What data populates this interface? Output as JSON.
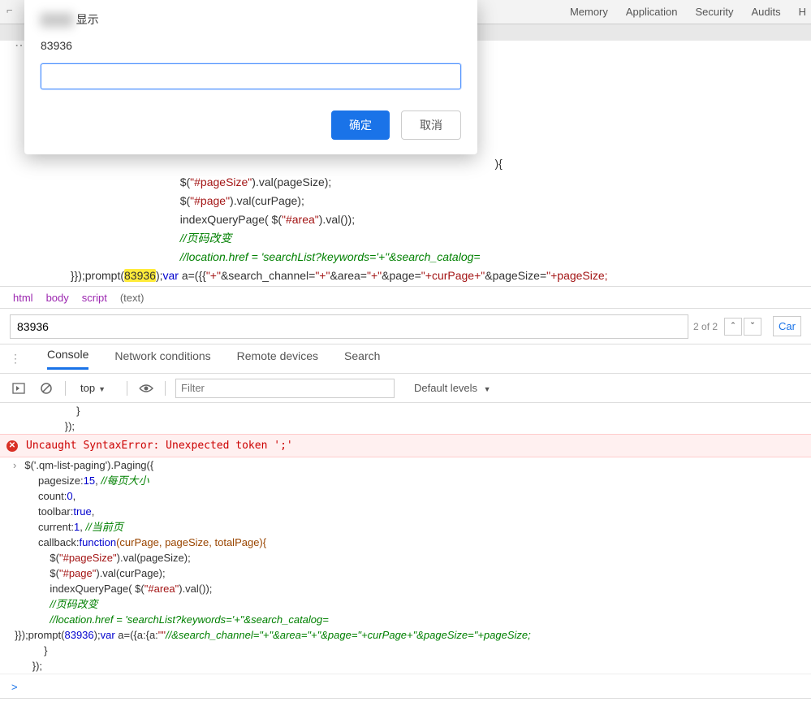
{
  "dialog": {
    "title_prefix": "████",
    "title_suffix": "显示",
    "message": "83936",
    "input_value": "",
    "ok_label": "确定",
    "cancel_label": "取消"
  },
  "top_tabs": [
    "Memory",
    "Application",
    "Security",
    "Audits",
    "H"
  ],
  "code_upper": {
    "brace_open": "){",
    "l1_a": "$(",
    "l1_b": "\"#pageSize\"",
    "l1_c": ").val(pageSize);",
    "l2_a": "$(",
    "l2_b": "\"#page\"",
    "l2_c": ").val(curPage);",
    "l3_a": "indexQueryPage( $(",
    "l3_b": "\"#area\"",
    "l3_c": ").val());",
    "c1": "//页码改变",
    "c2": "//location.href = 'searchList?keywords='+\"&search_catalog=",
    "last_a": "}});prompt(",
    "last_hl": "83936",
    "last_b": ");",
    "last_c": "var",
    "last_d": " a=({{",
    "last_e": "\"+\"",
    "last_f": "&search_channel=",
    "last_g": "\"+\"",
    "last_h": "&area=",
    "last_i": "\"+\"",
    "last_j": "&page=",
    "last_k": "\"+curPage+\"",
    "last_l": "&pageSize=",
    "last_m": "\"+pageSize;"
  },
  "breadcrumb": [
    "html",
    "body",
    "script",
    "(text)"
  ],
  "find": {
    "value": "83936",
    "count": "2 of 2",
    "cancel": "Car"
  },
  "console_tabs": [
    "Console",
    "Network conditions",
    "Remote devices",
    "Search"
  ],
  "toolbar": {
    "context": "top",
    "filter_placeholder": "Filter",
    "levels": "Default levels"
  },
  "console": {
    "pre1": "               }",
    "pre2": "           });",
    "error": "Uncaught SyntaxError: Unexpected token ';'",
    "l0": "$('.qm-list-paging').Paging({",
    "l1a": "pagesize:",
    "l1b": "15",
    "l1c": ", ",
    "l1d": "//每页大小",
    "l2a": "count:",
    "l2b": "0",
    "l2c": ",",
    "l3a": "toolbar:",
    "l3b": "true",
    "l3c": ",",
    "l4a": "current:",
    "l4b": "1",
    "l4c": ", ",
    "l4d": "//当前页",
    "l5a": "callback:",
    "l5b": "function",
    "l5c": "(curPage, pageSize, totalPage){",
    "l6a": "$(",
    "l6b": "\"#pageSize\"",
    "l6c": ").val(pageSize);",
    "l7a": "$(",
    "l7b": "\"#page\"",
    "l7c": ").val(curPage);",
    "l8a": "indexQueryPage( $(",
    "l8b": "\"#area\"",
    "l8c": ").val());",
    "c1": "//页码改变",
    "c2": "//location.href = 'searchList?keywords='+\"&search_catalog=",
    "l9a": "}});prompt(",
    "l9b": "83936",
    "l9c": ");",
    "l9d": "var",
    "l9e": " a=({a:{a:",
    "l9f": "\"\"",
    "l9g": "//&search_channel=\"+\"&area=\"+\"&page=\"+curPage+\"&pageSize=\"+pageSize;",
    "l10": "               }",
    "l11": "           });",
    "prompt": ">"
  }
}
